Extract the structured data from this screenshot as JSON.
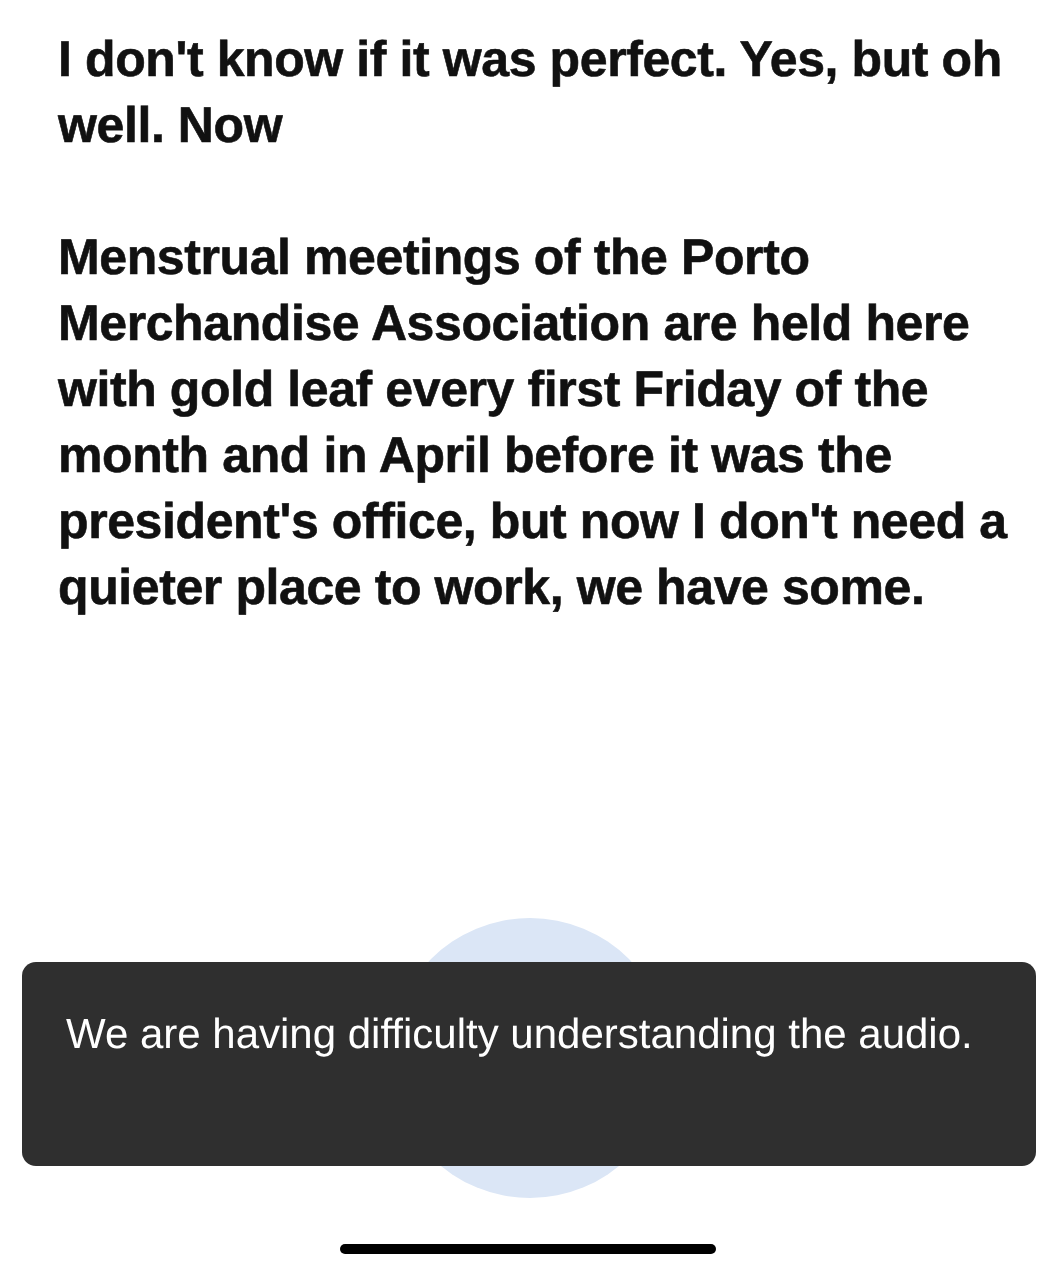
{
  "transcript": {
    "paragraphs": [
      "I don't know if it was perfect. Yes, but oh well. Now",
      "Menstrual meetings of the Porto Merchandise Association are held here with gold leaf every first Friday of the month and in April before it was the president's office, but now I don't need a quieter place to work, we have some."
    ]
  },
  "listening": {
    "active": true
  },
  "toast": {
    "message": "We are having difficulty understanding the audio."
  }
}
